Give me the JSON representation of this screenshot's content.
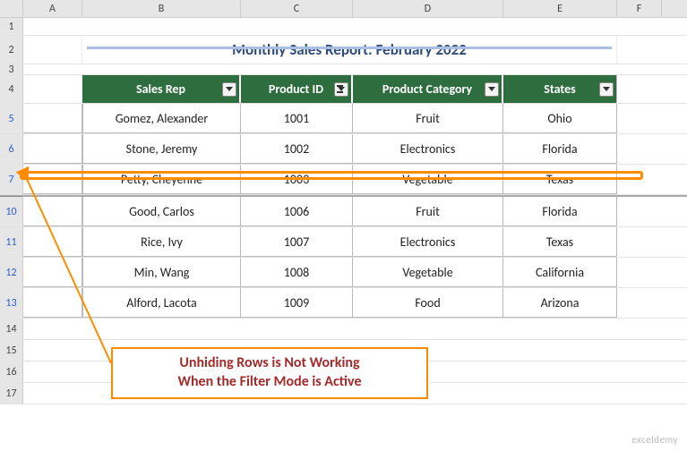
{
  "columns": [
    "A",
    "B",
    "C",
    "D",
    "E",
    "F"
  ],
  "title": "Monthly Sales Report: February 2022",
  "headers": {
    "salesRep": "Sales Rep",
    "productId": "Product ID",
    "category": "Product Category",
    "states": "States"
  },
  "rowLabels": {
    "r1": "1",
    "r2": "2",
    "r3": "3",
    "r4": "4",
    "r5": "5",
    "r6": "6",
    "r7": "7",
    "r10": "10",
    "r11": "11",
    "r12": "12",
    "r13": "13",
    "r14": "14",
    "r15": "15",
    "r16": "16",
    "r17": "17"
  },
  "data": [
    {
      "rep": "Gomez, Alexander",
      "pid": "1001",
      "cat": "Fruit",
      "state": "Ohio"
    },
    {
      "rep": "Stone, Jeremy",
      "pid": "1002",
      "cat": "Electronics",
      "state": "Florida"
    },
    {
      "rep": "Petty, Cheyenne",
      "pid": "1003",
      "cat": "Vegetable",
      "state": "Texas"
    },
    {
      "rep": "Good, Carlos",
      "pid": "1006",
      "cat": "Fruit",
      "state": "Florida"
    },
    {
      "rep": "Rice, Ivy",
      "pid": "1007",
      "cat": "Electronics",
      "state": "Texas"
    },
    {
      "rep": "Min, Wang",
      "pid": "1008",
      "cat": "Vegetable",
      "state": "California"
    },
    {
      "rep": "Alford, Lacota",
      "pid": "1009",
      "cat": "Food",
      "state": "Arizona"
    }
  ],
  "annotation": {
    "line1": "Unhiding Rows is Not Working",
    "line2": "When the Filter Mode is Active"
  },
  "watermark": "exceldemy",
  "chart_data": {
    "type": "table",
    "title": "Monthly Sales Report: February 2022",
    "columns": [
      "Sales Rep",
      "Product ID",
      "Product Category",
      "States"
    ],
    "rows": [
      [
        "Gomez, Alexander",
        "1001",
        "Fruit",
        "Ohio"
      ],
      [
        "Stone, Jeremy",
        "1002",
        "Electronics",
        "Florida"
      ],
      [
        "Petty, Cheyenne",
        "1003",
        "Vegetable",
        "Texas"
      ],
      [
        "Good, Carlos",
        "1006",
        "Fruit",
        "Florida"
      ],
      [
        "Rice, Ivy",
        "1007",
        "Electronics",
        "Texas"
      ],
      [
        "Min, Wang",
        "1008",
        "Vegetable",
        "California"
      ],
      [
        "Alford, Lacota",
        "1009",
        "Food",
        "Arizona"
      ]
    ],
    "hidden_rows": [
      8,
      9
    ],
    "filter_active": true
  }
}
